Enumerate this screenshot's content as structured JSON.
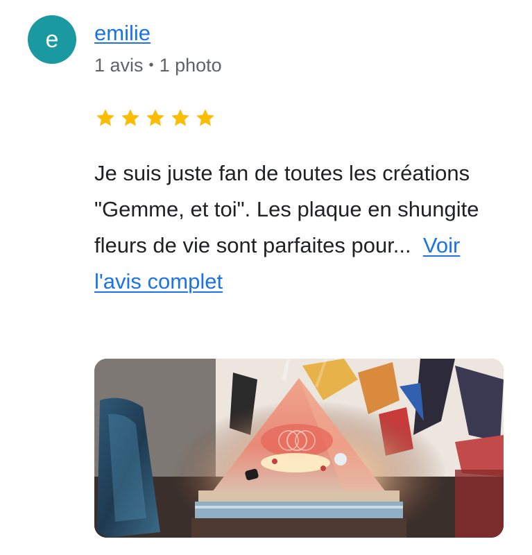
{
  "review": {
    "author": {
      "initial": "e",
      "name": "emilie",
      "avatar_color": "#1a9aa0"
    },
    "reviewer_stats": {
      "reviews": "1 avis",
      "separator": "•",
      "photos": "1 photo"
    },
    "rating": 5,
    "star_color": "#fbbc04",
    "text": "Je suis juste fan de toutes les créations \"Gemme, et toi\". Les plaque en shungite fleurs de vie sont parfaites pour...",
    "more_link": "Voir l'avis complet",
    "link_color": "#1a73e8"
  }
}
